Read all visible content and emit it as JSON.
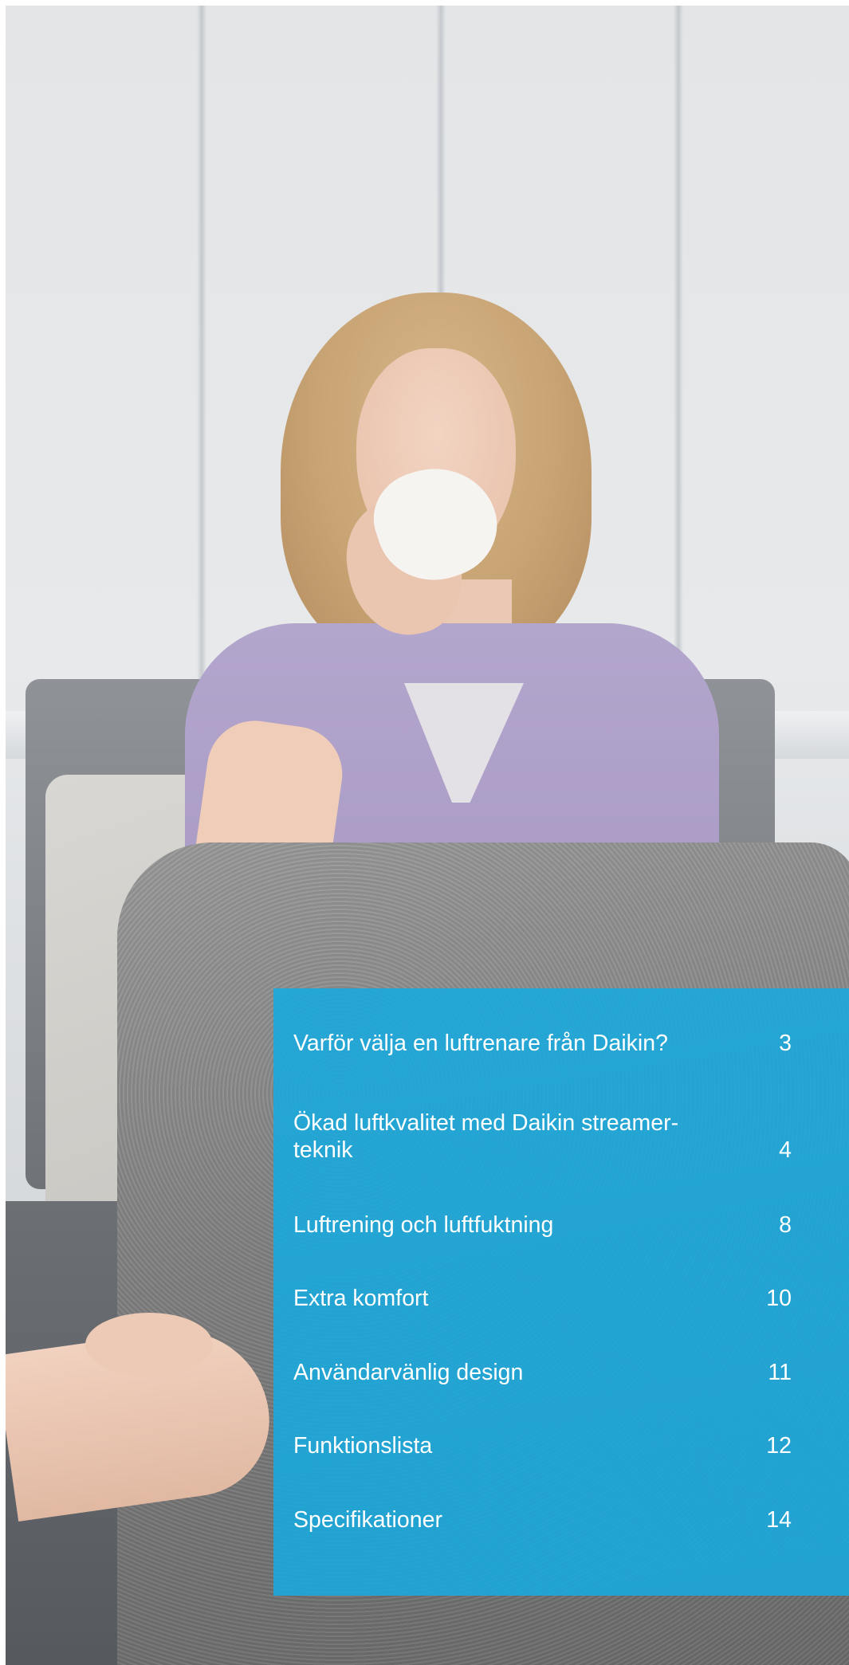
{
  "toc": {
    "items": [
      {
        "label": "Varför välja en luftrenare från Daikin?",
        "page": "3"
      },
      {
        "label": "Ökad luftkvalitet med Daikin streamer-teknik",
        "page": "4"
      },
      {
        "label": "Luftrening och luftfuktning",
        "page": "8"
      },
      {
        "label": "Extra komfort",
        "page": "10"
      },
      {
        "label": "Användarvänlig design",
        "page": "11"
      },
      {
        "label": "Funktionslista",
        "page": "12"
      },
      {
        "label": "Specifikationer",
        "page": "14"
      }
    ]
  },
  "colors": {
    "panel": "#17AADE",
    "text": "#FFFFFF"
  }
}
